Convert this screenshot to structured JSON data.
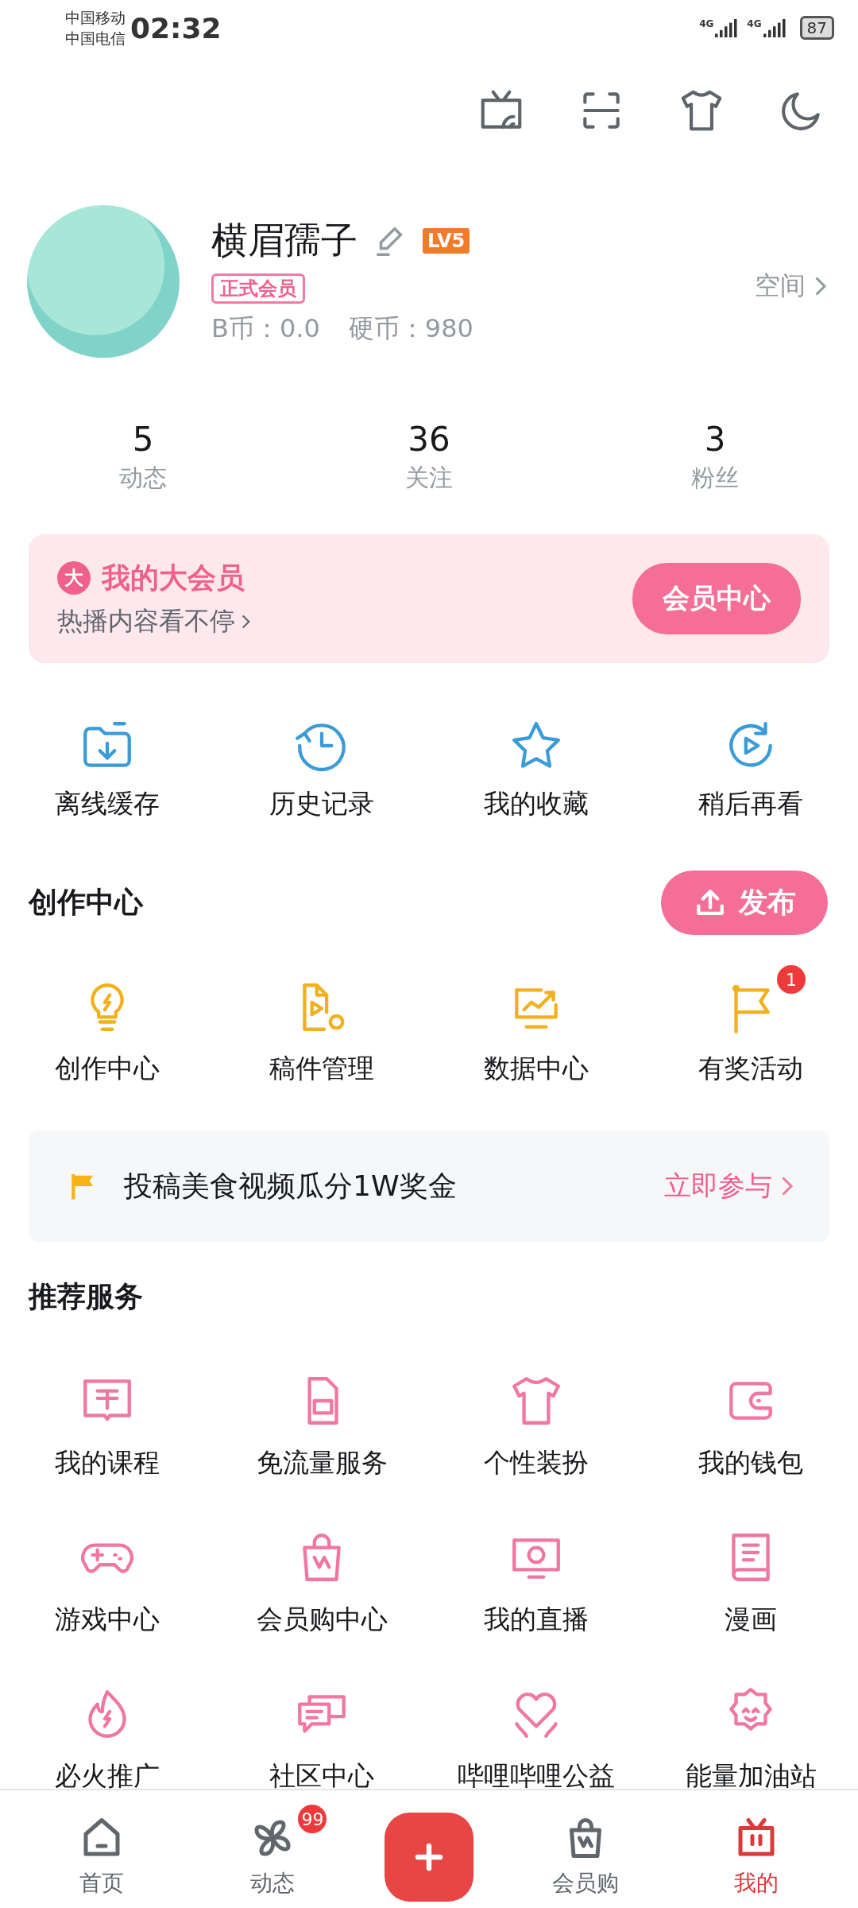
{
  "status_bar": {
    "carriers": [
      "中国移动",
      "中国电信"
    ],
    "time": "02:32",
    "networks": [
      "4G",
      "4G"
    ],
    "battery": "87"
  },
  "profile": {
    "name": "横眉孺子",
    "level": "LV5",
    "membership": "正式会员",
    "b_coins": "B币：0.0",
    "coins": "硬币：980",
    "space_link": "空间"
  },
  "stats": [
    {
      "value": "5",
      "label": "动态"
    },
    {
      "value": "36",
      "label": "关注"
    },
    {
      "value": "3",
      "label": "粉丝"
    }
  ],
  "vip_card": {
    "badge": "大",
    "title": "我的大会员",
    "subtitle": "热播内容看不停",
    "button": "会员中心"
  },
  "quick_actions": [
    "离线缓存",
    "历史记录",
    "我的收藏",
    "稍后再看"
  ],
  "creation": {
    "title": "创作中心",
    "publish_button": "发布",
    "items": [
      {
        "label": "创作中心"
      },
      {
        "label": "稿件管理"
      },
      {
        "label": "数据中心"
      },
      {
        "label": "有奖活动",
        "badge": "1"
      }
    ]
  },
  "banner": {
    "text": "投稿美食视频瓜分1W奖金",
    "action": "立即参与"
  },
  "services": {
    "title": "推荐服务",
    "items": [
      "我的课程",
      "免流量服务",
      "个性装扮",
      "我的钱包",
      "游戏中心",
      "会员购中心",
      "我的直播",
      "漫画",
      "必火推广",
      "社区中心",
      "哔哩哔哩公益",
      "能量加油站"
    ]
  },
  "bottom_nav": [
    {
      "label": "首页",
      "selected": false
    },
    {
      "label": "动态",
      "selected": false,
      "badge": "99"
    },
    {
      "kind": "plus"
    },
    {
      "label": "会员购",
      "selected": false
    },
    {
      "label": "我的",
      "selected": true
    }
  ]
}
